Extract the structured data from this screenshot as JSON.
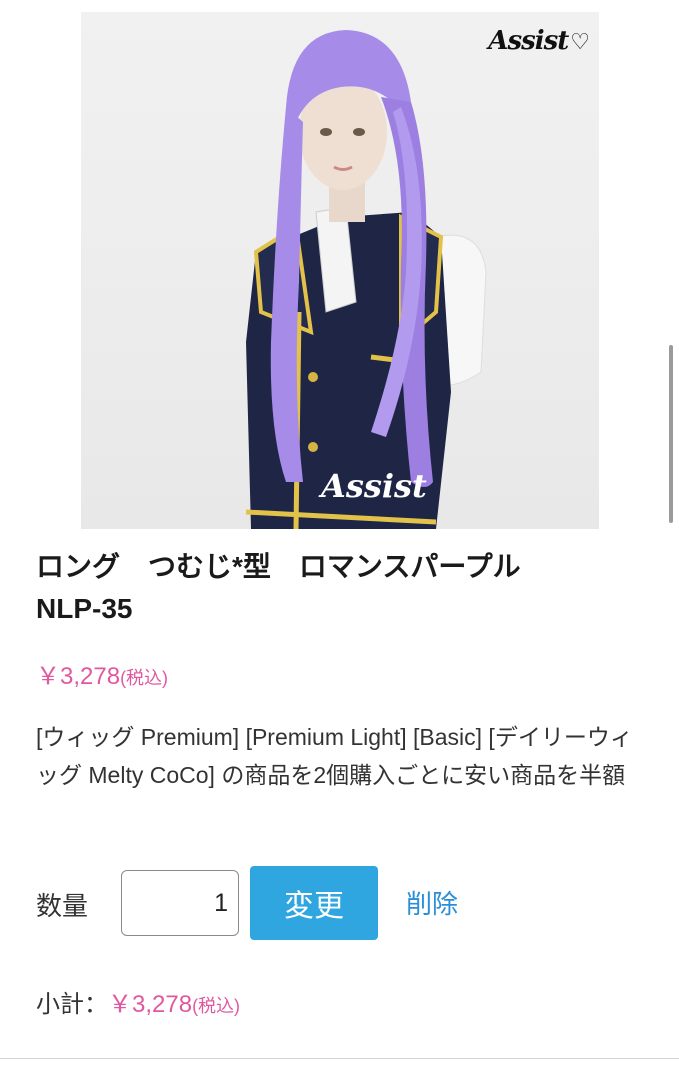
{
  "product": {
    "brand": "Assist",
    "title": "ロング　つむじ*型　ロマンスパープル\nNLP-35",
    "price": "￥3,278",
    "tax_note": "(税込)",
    "promo_text": "[ウィッグ Premium] [Premium Light] [Basic] [デイリーウィッグ Melty CoCo] の商品を2個購入ごとに安い商品を半額"
  },
  "cart": {
    "quantity_label": "数量",
    "quantity_value": "1",
    "change_label": "変更",
    "delete_label": "削除",
    "subtotal_label": "小計：",
    "subtotal_value": "￥3,278",
    "subtotal_tax": "(税込)"
  },
  "colors": {
    "price_pink": "#e0589f",
    "button_blue": "#2fa6df",
    "link_blue": "#2a8fd8",
    "wig_purple": "#a78be8",
    "vest_navy": "#1f2645",
    "trim_gold": "#e3c24a"
  }
}
